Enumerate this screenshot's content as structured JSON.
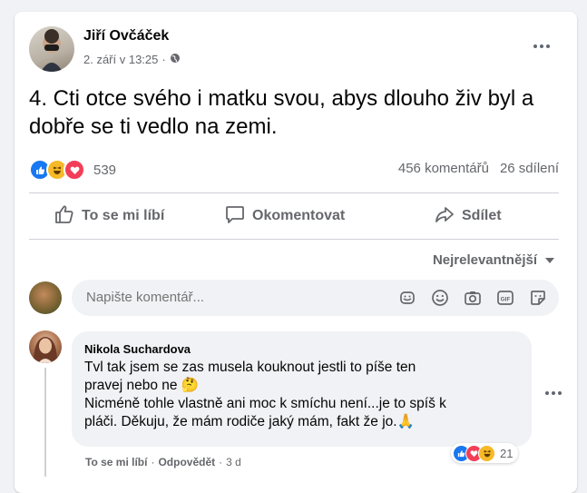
{
  "post": {
    "author": "Jiří Ovčáček",
    "date": "2. září v 13:25",
    "dot": "·",
    "text": "4. Cti otce svého i matku svou, abys dlouho živ byl a dobře se ti vedlo na zemi.",
    "reaction_icons": [
      "like",
      "haha",
      "love"
    ],
    "reaction_count": "539",
    "comment_count": "456 komentářů",
    "share_count": "26 sdílení"
  },
  "actions": {
    "like": "To se mi líbí",
    "comment": "Okomentovat",
    "share": "Sdílet"
  },
  "sort": {
    "label": "Nejrelevantnější"
  },
  "composer": {
    "placeholder": "Napište komentář...",
    "icons": [
      "sticker-face-icon",
      "emoji-icon",
      "camera-icon",
      "gif-icon",
      "sticker-icon"
    ]
  },
  "comment": {
    "author": "Nikola Suchardova",
    "line1": "Tvl tak jsem se zas musela kouknout jestli to píše ten",
    "line2": "pravej nebo ne 🤔",
    "line3": "Nicméně tohle vlastně ani moc k smíchu není...je to spíš k",
    "line4": "pláči. Děkuju, že mám rodiče jaký mám, fakt že jo.🙏",
    "reaction_icons": [
      "like",
      "love",
      "haha"
    ],
    "reaction_count": "21",
    "like_label": "To se mi líbí",
    "reply_label": "Odpovědět",
    "time": "3 d",
    "dot": "·"
  },
  "colors": {
    "accent": "#1877f2",
    "secondary_text": "#65676b",
    "bubble": "#f0f2f5",
    "background": "#f0f2f5"
  }
}
